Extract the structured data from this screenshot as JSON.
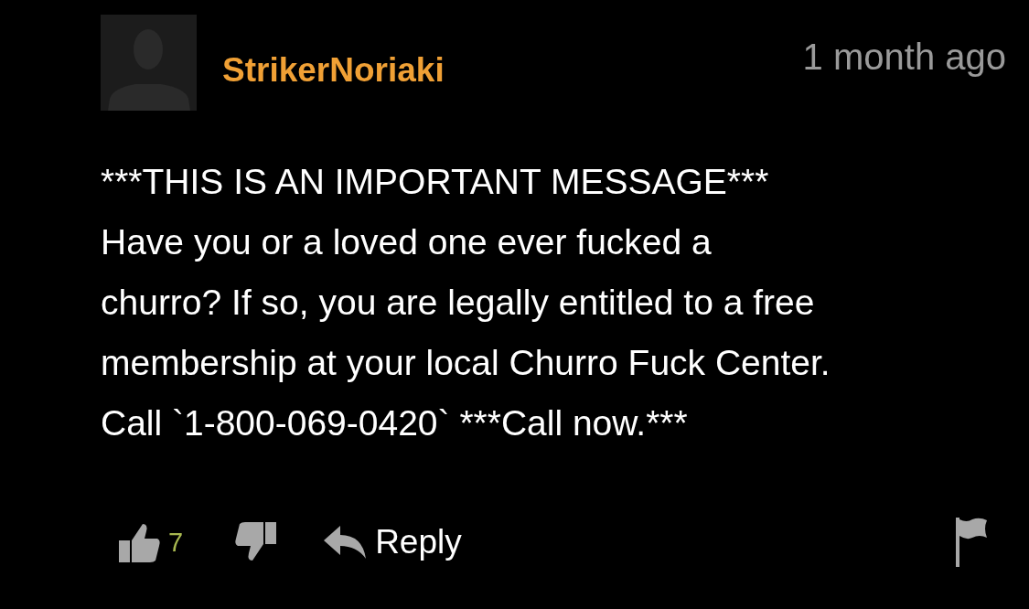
{
  "comment": {
    "author": "StrikerNoriaki",
    "time": "1 month ago",
    "body_lines": [
      "***THIS IS AN IMPORTANT MESSAGE***",
      "Have you or a loved one ever fucked a",
      "churro? If so, you are legally entitled to a free",
      "membership at your local Churro Fuck Center.",
      "Call `1-800-069-0420` ***Call now.***"
    ],
    "likes": "7",
    "reply": "Reply"
  }
}
